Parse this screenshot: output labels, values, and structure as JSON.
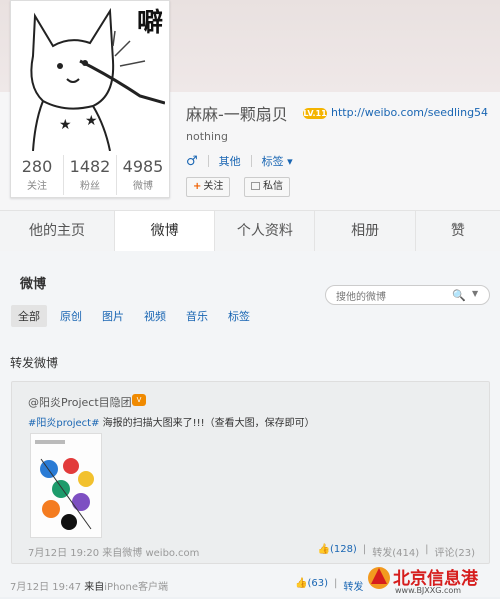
{
  "profile": {
    "name": "麻麻-一颗扇贝",
    "level": "LV.11",
    "url": "http://weibo.com/seedling54",
    "bio": "nothing",
    "gender_icon": "♂",
    "location": "其他",
    "tags_label": "标签",
    "follow_label": "关注",
    "message_label": "私信",
    "avatar_caption": "噼"
  },
  "stats": [
    {
      "value": "280",
      "label": "关注"
    },
    {
      "value": "1482",
      "label": "粉丝"
    },
    {
      "value": "4985",
      "label": "微博"
    }
  ],
  "tabs": [
    {
      "label": "他的主页"
    },
    {
      "label": "微博"
    },
    {
      "label": "个人资料"
    },
    {
      "label": "相册"
    },
    {
      "label": "赞"
    }
  ],
  "section": {
    "title": "微博",
    "search_placeholder": "搜他的微博",
    "filters": [
      "全部",
      "原创",
      "图片",
      "视频",
      "音乐",
      "标签"
    ],
    "repost_title": "转发微博"
  },
  "repost": {
    "author": "@阳炎Project目隐团",
    "badge": "V",
    "tag": "#阳炎project#",
    "text": " 海报的扫描大图来了!!!（查看大图，保存即可）",
    "time": "7月12日 19:20",
    "source_prefix": "来自",
    "source": "微博 weibo.com",
    "likes": "(128)",
    "repost": "转发(414)",
    "comments": "评论(23)"
  },
  "post_footer": {
    "time": "7月12日 19:47",
    "source_prefix": "来自",
    "source": "iPhone客户端",
    "likes": "(63)",
    "repost": "转发"
  },
  "watermark": {
    "title": "北京信息港",
    "url": "www.BJXXG.com"
  }
}
